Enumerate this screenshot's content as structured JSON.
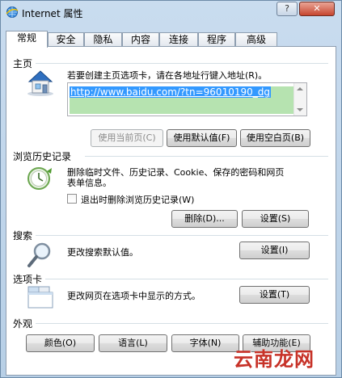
{
  "window": {
    "title": "Internet 属性",
    "help_label": "?",
    "close_label": "✕"
  },
  "tabs": [
    {
      "label": "常规",
      "active": true
    },
    {
      "label": "安全"
    },
    {
      "label": "隐私"
    },
    {
      "label": "内容"
    },
    {
      "label": "连接"
    },
    {
      "label": "程序"
    },
    {
      "label": "高级"
    }
  ],
  "homepage": {
    "section_label": "主页",
    "description": "若要创建主页选项卡，请在各地址行键入地址(R)。",
    "url": "http://www.baidu.com/?tn=96010190_dg",
    "use_current_label": "使用当前页(C)",
    "use_default_label": "使用默认值(F)",
    "use_blank_label": "使用空白页(B)"
  },
  "history": {
    "section_label": "浏览历史记录",
    "description_line1": "删除临时文件、历史记录、Cookie、保存的密码和网页",
    "description_line2": "表单信息。",
    "checkbox_label": "退出时删除浏览历史记录(W)",
    "delete_label": "删除(D)...",
    "settings_label": "设置(S)"
  },
  "search": {
    "section_label": "搜索",
    "description": "更改搜索默认值。",
    "settings_label": "设置(I)"
  },
  "tabs_section": {
    "section_label": "选项卡",
    "description": "更改网页在选项卡中显示的方式。",
    "settings_label": "设置(T)"
  },
  "appearance": {
    "section_label": "外观",
    "colors_label": "颜色(O)",
    "languages_label": "语言(L)",
    "fonts_label": "字体(N)",
    "accessibility_label": "辅助功能(E)"
  },
  "watermark": {
    "text": "云南龙网"
  },
  "colors": {
    "url_highlight": "#3399ff",
    "url_bg": "#b6e3b0",
    "watermark": "#c73228"
  }
}
